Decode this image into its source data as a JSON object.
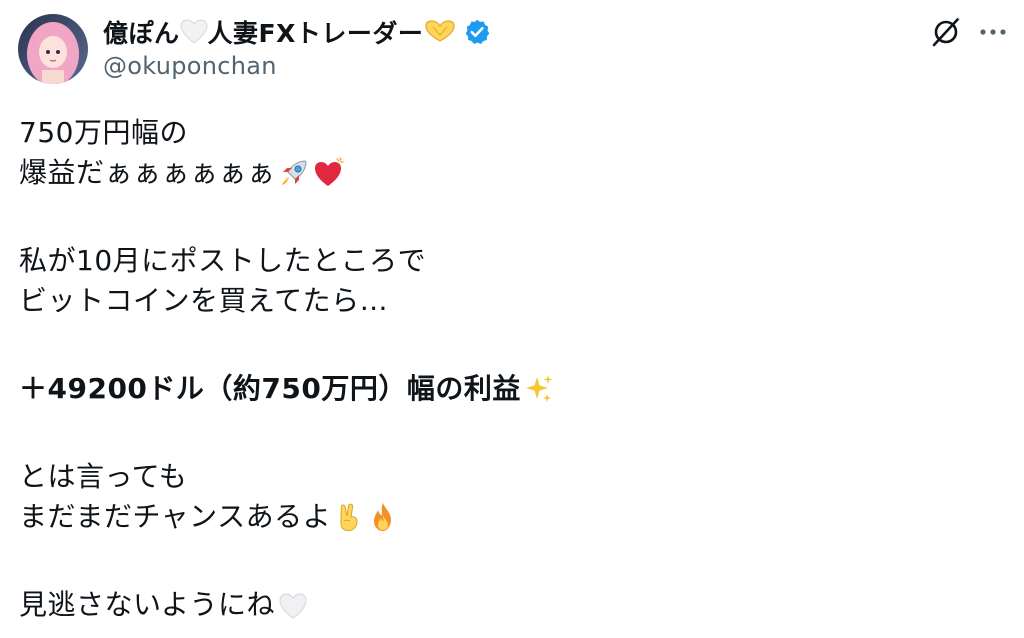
{
  "author": {
    "display_name_part1": "億ぽん",
    "display_name_part2": "人妻FXトレーダー",
    "handle": "@okuponchan",
    "avatar_icon": "avatar-pink-hair",
    "verified_icon": "verified-badge-icon"
  },
  "actions": {
    "grok_icon": "grok-icon",
    "more_icon": "more-options-icon"
  },
  "post": {
    "line1": "750万円幅の",
    "line2": "爆益だぁぁぁぁぁぁ",
    "line3": "私が10月にポストしたところで",
    "line4": "ビットコインを買えてたら…",
    "line5": "＋49200ドル（約750万円）幅の利益",
    "line6": "とは言っても",
    "line7": "まだまだチャンスあるよ",
    "line8": "見逃さないようにね"
  },
  "colors": {
    "text": "#0f1419",
    "secondary": "#536471",
    "verified": "#1d9bf0"
  }
}
